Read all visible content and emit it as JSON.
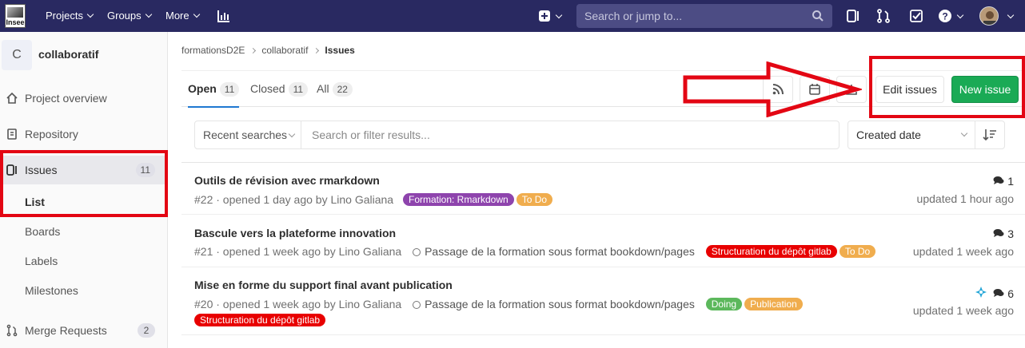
{
  "topbar": {
    "logo_text": "Insee",
    "nav": [
      "Projects",
      "Groups",
      "More"
    ],
    "search_placeholder": "Search or jump to..."
  },
  "sidebar": {
    "project_initial": "C",
    "project_name": "collaboratif",
    "items": [
      {
        "label": "Project overview",
        "icon": "home-icon"
      },
      {
        "label": "Repository",
        "icon": "doc-icon"
      },
      {
        "label": "Issues",
        "icon": "issues-icon",
        "count": "11"
      },
      {
        "label": "Merge Requests",
        "icon": "merge-request-icon",
        "count": "2"
      }
    ],
    "issues_sub": [
      "List",
      "Boards",
      "Labels",
      "Milestones"
    ]
  },
  "breadcrumb": [
    "formationsD2E",
    "collaboratif",
    "Issues"
  ],
  "tabs": [
    {
      "label": "Open",
      "count": "11"
    },
    {
      "label": "Closed",
      "count": "11"
    },
    {
      "label": "All",
      "count": "22"
    }
  ],
  "actions": {
    "edit": "Edit issues",
    "new": "New issue"
  },
  "filter": {
    "recent": "Recent searches",
    "placeholder": "Search or filter results...",
    "sort": "Created date"
  },
  "issues": [
    {
      "title": "Outils de révision avec rmarkdown",
      "meta": "#22 · opened 1 day ago by Lino Galiana",
      "labels": [
        {
          "text": "Formation: Rmarkdown",
          "color": "#8e44ad"
        },
        {
          "text": "To Do",
          "color": "#f0ad4e"
        }
      ],
      "comments": "1",
      "updated": "updated 1 hour ago"
    },
    {
      "title": "Bascule vers la plateforme innovation",
      "meta": "#21 · opened 1 week ago by Lino Galiana",
      "milestone": "Passage de la formation sous format bookdown/pages",
      "labels": [
        {
          "text": "Structuration du dépôt gitlab",
          "color": "#e80000"
        },
        {
          "text": "To Do",
          "color": "#f0ad4e"
        }
      ],
      "comments": "3",
      "updated": "updated 1 week ago"
    },
    {
      "title": "Mise en forme du support final avant publication",
      "meta": "#20 · opened 1 week ago by Lino Galiana",
      "milestone": "Passage de la formation sous format bookdown/pages",
      "labels": [
        {
          "text": "Doing",
          "color": "#5cb85c"
        },
        {
          "text": "Publication",
          "color": "#f0ad4e"
        }
      ],
      "labels2": [
        {
          "text": "Structuration du dépôt gitlab",
          "color": "#e80000"
        }
      ],
      "comments": "6",
      "updated": "updated 1 week ago"
    }
  ],
  "colors": {
    "topbar": "#292961",
    "accent": "#1aaa55",
    "annotation": "#e30613"
  }
}
